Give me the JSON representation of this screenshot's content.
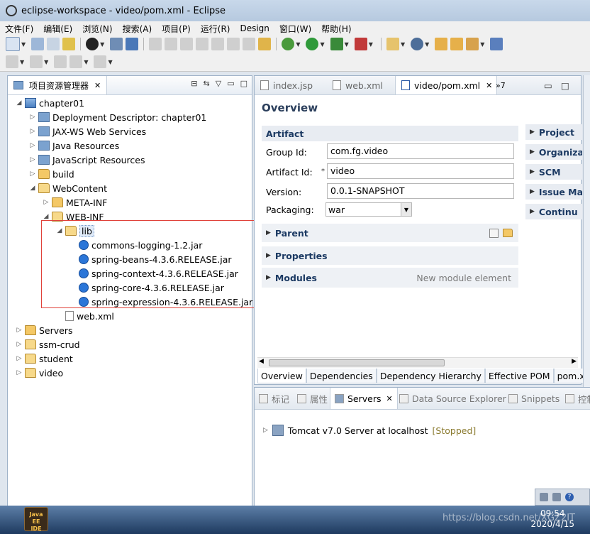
{
  "window": {
    "title": "eclipse-workspace - video/pom.xml - Eclipse"
  },
  "menu": [
    "文件(F)",
    "编辑(E)",
    "浏览(N)",
    "搜索(A)",
    "项目(P)",
    "运行(R)",
    "Design",
    "窗口(W)",
    "帮助(H)"
  ],
  "explorer": {
    "tab_label": "项目资源管理器",
    "close": "✕",
    "tree": [
      {
        "label": "chapter01",
        "depth": 0,
        "expanded": true,
        "icon": "project-icon"
      },
      {
        "label": "Deployment Descriptor: chapter01",
        "depth": 1,
        "expanded": false,
        "icon": "deployment-icon"
      },
      {
        "label": "JAX-WS Web Services",
        "depth": 1,
        "expanded": false,
        "icon": "webservice-icon"
      },
      {
        "label": "Java Resources",
        "depth": 1,
        "expanded": false,
        "icon": "java-resources-icon"
      },
      {
        "label": "JavaScript Resources",
        "depth": 1,
        "expanded": false,
        "icon": "js-resources-icon"
      },
      {
        "label": "build",
        "depth": 1,
        "expanded": false,
        "icon": "folder-icon"
      },
      {
        "label": "WebContent",
        "depth": 1,
        "expanded": true,
        "icon": "folder-open-icon"
      },
      {
        "label": "META-INF",
        "depth": 2,
        "expanded": false,
        "icon": "folder-icon"
      },
      {
        "label": "WEB-INF",
        "depth": 2,
        "expanded": true,
        "icon": "folder-open-icon"
      },
      {
        "label": "lib",
        "depth": 3,
        "expanded": true,
        "icon": "folder-open-icon",
        "selected": true
      },
      {
        "label": "commons-logging-1.2.jar",
        "depth": 4,
        "icon": "jar-icon"
      },
      {
        "label": "spring-beans-4.3.6.RELEASE.jar",
        "depth": 4,
        "icon": "jar-icon"
      },
      {
        "label": "spring-context-4.3.6.RELEASE.jar",
        "depth": 4,
        "icon": "jar-icon"
      },
      {
        "label": "spring-core-4.3.6.RELEASE.jar",
        "depth": 4,
        "icon": "jar-icon"
      },
      {
        "label": "spring-expression-4.3.6.RELEASE.jar",
        "depth": 4,
        "icon": "jar-icon"
      },
      {
        "label": "web.xml",
        "depth": 3,
        "icon": "xml-file-icon"
      },
      {
        "label": "Servers",
        "depth": 0,
        "expanded": false,
        "icon": "folder-icon"
      },
      {
        "label": "ssm-crud",
        "depth": 0,
        "expanded": false,
        "icon": "maven-project-icon"
      },
      {
        "label": "student",
        "depth": 0,
        "expanded": false,
        "icon": "maven-project-icon"
      },
      {
        "label": "video",
        "depth": 0,
        "expanded": false,
        "icon": "maven-project-icon"
      }
    ]
  },
  "editor": {
    "tabs": [
      {
        "label": "index.jsp",
        "active": false
      },
      {
        "label": "web.xml",
        "active": false
      },
      {
        "label": "video/pom.xml",
        "active": true
      }
    ],
    "more_tabs": "»7",
    "overview_title": "Overview",
    "artifact": {
      "header": "Artifact",
      "group_label": "Group Id:",
      "group_value": "com.fg.video",
      "artifact_label": "Artifact Id:",
      "artifact_value": "video",
      "version_label": "Version:",
      "version_value": "0.0.1-SNAPSHOT",
      "packaging_label": "Packaging:",
      "packaging_value": "war"
    },
    "sections": [
      {
        "label": "Parent"
      },
      {
        "label": "Properties"
      },
      {
        "label": "Modules",
        "hint": "New module element"
      }
    ],
    "right_sections": [
      "Project",
      "Organiza",
      "SCM",
      "Issue Ma",
      "Continu"
    ],
    "pom_tabs": [
      "Overview",
      "Dependencies",
      "Dependency Hierarchy",
      "Effective POM",
      "pom.xml"
    ]
  },
  "bottom": {
    "tabs": [
      {
        "label": "标记",
        "active": false
      },
      {
        "label": "属性",
        "active": false
      },
      {
        "label": "Servers",
        "active": true
      },
      {
        "label": "Data Source Explorer",
        "active": false
      },
      {
        "label": "Snippets",
        "active": false
      },
      {
        "label": "控制",
        "active": false
      }
    ],
    "server_name": "Tomcat v7.0 Server at localhost",
    "server_status": "[Stopped]"
  },
  "taskbar": {
    "app_label_line1": "Java EE",
    "app_label_line2": "IDE",
    "time": "09:54",
    "date": "2020/4/15",
    "watermark": "https://blog.csdn.net/XGZ2IT"
  },
  "colors": {
    "selection_box": "#e0423a",
    "header_text": "#1c3a63"
  }
}
